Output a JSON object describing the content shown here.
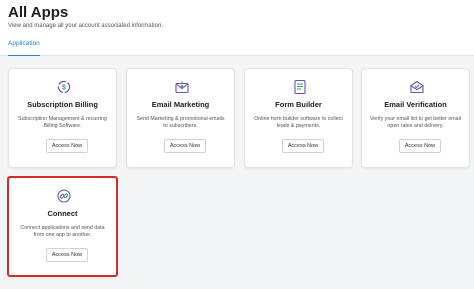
{
  "header": {
    "title": "All Apps",
    "subtitle": "View and manage all your account associated information.",
    "tabs": [
      {
        "label": "Application",
        "active": true
      }
    ]
  },
  "apps": [
    {
      "icon": "subscription-billing-icon",
      "title": "Subscription Billing",
      "description": "Subscription Management & recurring Billing Software.",
      "button": "Access Now"
    },
    {
      "icon": "email-marketing-icon",
      "title": "Email Marketing",
      "description": "Send Marketing & promotional emails to subscribers.",
      "button": "Access Now"
    },
    {
      "icon": "form-builder-icon",
      "title": "Form Builder",
      "description": "Online form builder software to collect leads & payments.",
      "button": "Access Now"
    },
    {
      "icon": "email-verification-icon",
      "title": "Email Verification",
      "description": "Verify your email list to get better email open rates and delivery.",
      "button": "Access Now"
    },
    {
      "icon": "connect-icon",
      "title": "Connect",
      "description": "Connect applications and send data from one app to another.",
      "button": "Access Now",
      "highlighted": true
    }
  ],
  "colors": {
    "accent": "#2f7fd1",
    "highlight": "#d62b2b",
    "icon_purple": "#6b4fbb",
    "icon_green": "#3aa35c"
  }
}
